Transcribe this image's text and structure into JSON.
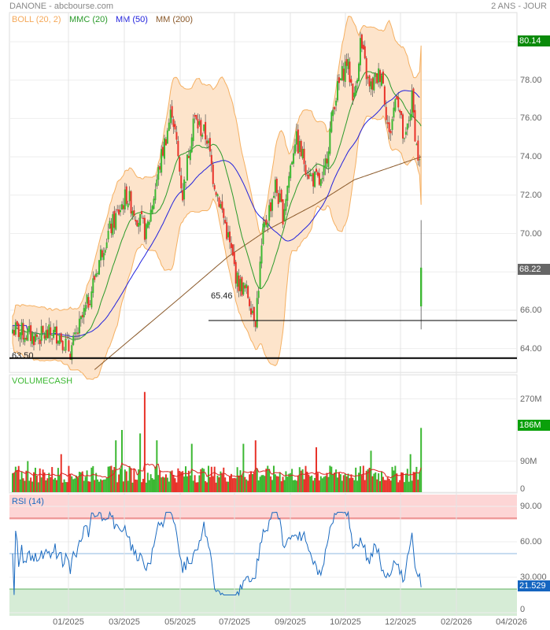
{
  "header": {
    "title": "DANONE - abcbourse.com",
    "period": "2 ANS - JOUR"
  },
  "legend": {
    "boll": "BOLL (20, 2)",
    "mmc": "MMC (20)",
    "mm50": "MM (50)",
    "mm200": "MM (200)"
  },
  "colors": {
    "up": "#3cb832",
    "down": "#e8332a",
    "boll_fill": "#fde4cb",
    "boll_line": "#f5b062",
    "mmc": "#2a9a2a",
    "mm50": "#2222dd",
    "mm200": "#8b5a2b",
    "last_up": "#0a8a0a",
    "last_price": "#666666",
    "rsi": "#1a6ac0"
  },
  "chart_data": [
    {
      "type": "candlestick",
      "title": "DANONE",
      "ylim": [
        63,
        81.5
      ],
      "y_ticks": [
        "80.00",
        "78.00",
        "76.00",
        "74.00",
        "72.00",
        "70.00",
        "68.00",
        "66.00",
        "64.00"
      ],
      "y_tick_values": [
        80,
        78,
        76,
        74,
        72,
        70,
        68,
        66,
        64
      ],
      "x_ticks": [
        "01/2025",
        "03/2025",
        "05/2025",
        "07/2025",
        "09/2025",
        "10/2025",
        "12/2025",
        "02/2026",
        "04/2026"
      ],
      "close_waypoints_day_price": [
        [
          0,
          65
        ],
        [
          15,
          64.6
        ],
        [
          30,
          64.8
        ],
        [
          38,
          63.9
        ],
        [
          41,
          64.4
        ],
        [
          50,
          66.5
        ],
        [
          60,
          69.5
        ],
        [
          75,
          72
        ],
        [
          88,
          70
        ],
        [
          98,
          74
        ],
        [
          105,
          76.5
        ],
        [
          112,
          72
        ],
        [
          119,
          76
        ],
        [
          128,
          75
        ],
        [
          132,
          73
        ],
        [
          140,
          70.5
        ],
        [
          148,
          67.5
        ],
        [
          155,
          66.8
        ],
        [
          160,
          65.6
        ],
        [
          165,
          70
        ],
        [
          173,
          72.5
        ],
        [
          178,
          71
        ],
        [
          186,
          75
        ],
        [
          196,
          73
        ],
        [
          204,
          72.5
        ],
        [
          212,
          77
        ],
        [
          220,
          79
        ],
        [
          225,
          77
        ],
        [
          229,
          80
        ],
        [
          235,
          77.5
        ],
        [
          243,
          78.5
        ],
        [
          248,
          75
        ],
        [
          253,
          77.5
        ],
        [
          258,
          74.5
        ],
        [
          263,
          77
        ],
        [
          266,
          74.5
        ],
        [
          268,
          73.6
        ]
      ],
      "last_candle": {
        "open": 66.2,
        "high": 70.7,
        "low": 65.0,
        "close": 68.22
      },
      "mm200_waypoints_day_price": [
        [
          54,
          62.9
        ],
        [
          111,
          66.7
        ],
        [
          142,
          68.8
        ],
        [
          168,
          70.2
        ],
        [
          199,
          71.5
        ],
        [
          225,
          72.8
        ],
        [
          269,
          74
        ]
      ],
      "levels": [
        {
          "label": "63.50",
          "value": 63.5
        },
        {
          "label": "65.46",
          "value": 65.46
        }
      ],
      "tags": {
        "high": "80.14",
        "last": "68.22"
      }
    },
    {
      "type": "bar",
      "title": "VOLUMECASH",
      "y_ticks": [
        "270M",
        "90M",
        "0"
      ],
      "y_tick_values": [
        270,
        90,
        0
      ],
      "unit": "M",
      "base_volume": 55,
      "spikes_day_value": [
        [
          10,
          90
        ],
        [
          32,
          110
        ],
        [
          68,
          150
        ],
        [
          72,
          180
        ],
        [
          84,
          170
        ],
        [
          87,
          290
        ],
        [
          95,
          150
        ],
        [
          118,
          140
        ],
        [
          152,
          140
        ],
        [
          160,
          150
        ],
        [
          200,
          130
        ],
        [
          236,
          120
        ],
        [
          262,
          110
        ],
        [
          269,
          186
        ]
      ],
      "tag": "186M"
    },
    {
      "type": "line",
      "title": "RSI (14)",
      "y_ticks": [
        "90.00",
        "60.00",
        "30.000",
        "0"
      ],
      "y_tick_values": [
        90,
        60,
        30,
        0
      ],
      "zones": {
        "overbought": 80,
        "oversold": 20,
        "mid": 50
      },
      "tag": "21.529",
      "last": 21.529
    }
  ]
}
